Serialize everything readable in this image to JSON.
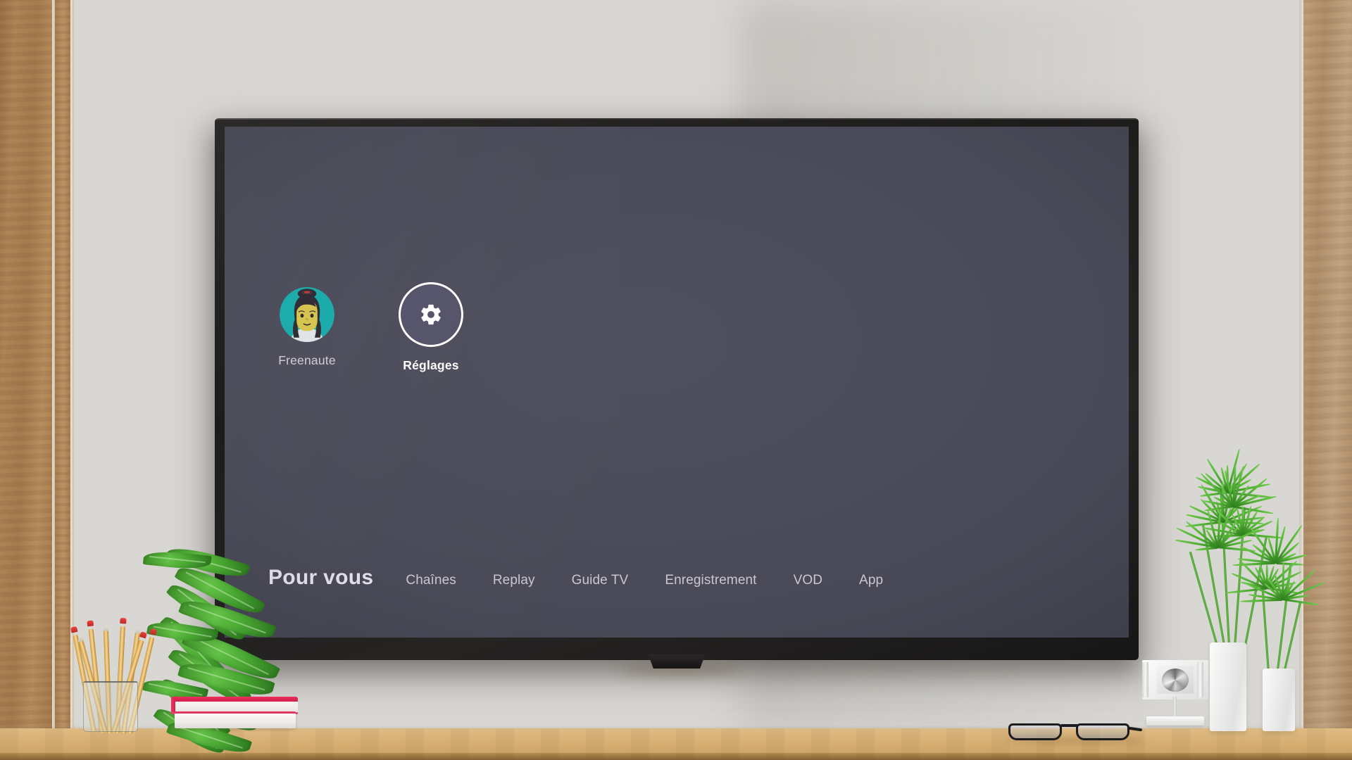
{
  "screen": {
    "background_color": "#4a4a58",
    "tiles": [
      {
        "name": "Freenaute",
        "label": "Freenaute",
        "type": "profile-avatar",
        "bold": false,
        "avatar": {
          "bg_color": "#18a9a9",
          "hair_color": "#2e2a33",
          "skin_color": "#d4c44a",
          "clip_color": "#d9312d"
        }
      },
      {
        "name": "Reglages",
        "label": "Réglages",
        "type": "settings-gear",
        "bold": true,
        "circle_color": "#545369",
        "ring_color": "#ffffff",
        "icon": "gear-icon"
      }
    ],
    "nav": {
      "active_index": 0,
      "items": [
        {
          "label": "Pour vous"
        },
        {
          "label": "Chaînes"
        },
        {
          "label": "Replay"
        },
        {
          "label": "Guide TV"
        },
        {
          "label": "Enregistrement"
        },
        {
          "label": "VOD"
        },
        {
          "label": "App"
        }
      ],
      "active_color": "#e2e0ea",
      "inactive_color": "#c9c7d4"
    }
  },
  "room": {
    "wall_color": "#dcd9d4",
    "desk_color": "#d4ab6e",
    "wood_panel_left_color": "#a67c4f",
    "wood_panel_right_color": "#b18f6b",
    "tv_frame_color": "#1d1c1b",
    "props": [
      {
        "name": "plant-left",
        "description": "potted green leafy plant"
      },
      {
        "name": "pencil-cup",
        "description": "glass cup of yellow pencils"
      },
      {
        "name": "books",
        "description": "two stacked books with pink covers"
      },
      {
        "name": "eyeglasses",
        "description": "black eyeglasses on shelf"
      },
      {
        "name": "plant-right",
        "description": "white vases with papyrus grass"
      },
      {
        "name": "ornament",
        "description": "silver disc decorative ornament"
      }
    ]
  }
}
